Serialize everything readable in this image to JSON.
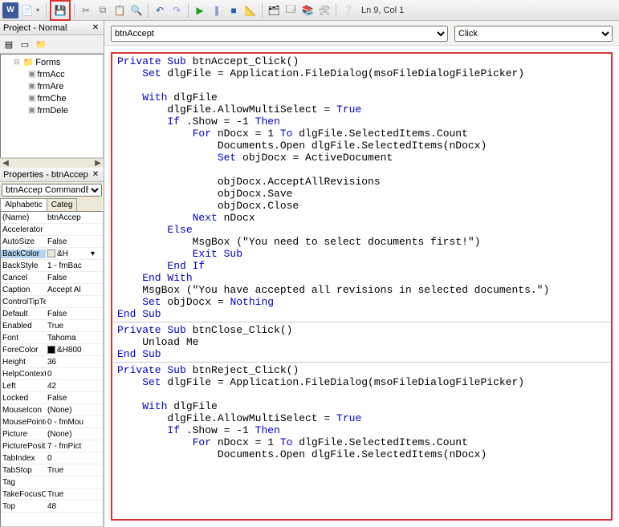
{
  "toolbar": {
    "linecol": "Ln 9, Col 1"
  },
  "project_pane": {
    "title": "Project - Normal",
    "folder": "Forms",
    "items": [
      "frmAcc",
      "frmAre",
      "frmChe",
      "frmDele"
    ]
  },
  "properties_pane": {
    "title": "Properties - btnAccep",
    "object_txt": "btnAccep CommandButton",
    "tabs": {
      "alpha": "Alphabetic",
      "categ": "Categ"
    },
    "rows": [
      {
        "name": "(Name)",
        "value": "btnAccep"
      },
      {
        "name": "Accelerator",
        "value": ""
      },
      {
        "name": "AutoSize",
        "value": "False"
      },
      {
        "name": "BackColor",
        "value": "&H",
        "swatch": "#ece9d8",
        "sel": true,
        "drop": true
      },
      {
        "name": "BackStyle",
        "value": "1 - fmBac"
      },
      {
        "name": "Cancel",
        "value": "False"
      },
      {
        "name": "Caption",
        "value": "Accept Al"
      },
      {
        "name": "ControlTipText",
        "value": ""
      },
      {
        "name": "Default",
        "value": "False"
      },
      {
        "name": "Enabled",
        "value": "True"
      },
      {
        "name": "Font",
        "value": "Tahoma"
      },
      {
        "name": "ForeColor",
        "value": "&H800",
        "swatch": "#000000"
      },
      {
        "name": "Height",
        "value": "36"
      },
      {
        "name": "HelpContextID",
        "value": "0"
      },
      {
        "name": "Left",
        "value": "42"
      },
      {
        "name": "Locked",
        "value": "False"
      },
      {
        "name": "MouseIcon",
        "value": "(None)"
      },
      {
        "name": "MousePointer",
        "value": "0 - fmMou"
      },
      {
        "name": "Picture",
        "value": "(None)"
      },
      {
        "name": "PicturePosition",
        "value": "7 - fmPict"
      },
      {
        "name": "TabIndex",
        "value": "0"
      },
      {
        "name": "TabStop",
        "value": "True"
      },
      {
        "name": "Tag",
        "value": ""
      },
      {
        "name": "TakeFocusOnClick",
        "value": "True"
      },
      {
        "name": "Top",
        "value": "48"
      }
    ]
  },
  "code_header": {
    "object": "btnAccept",
    "proc": "Click"
  },
  "code": {
    "l1a": "Private Sub",
    "l1b": " btnAccept_Click()",
    "l2a": "    Set",
    "l2b": " dlgFile = Application.FileDialog(msoFileDialogFilePicker)",
    "l3a": "    With",
    "l3b": " dlgFile",
    "l4": "        dlgFile.AllowMultiSelect = ",
    "l4k": "True",
    "l5a": "        If",
    "l5b": " .Show = -1 ",
    "l5c": "Then",
    "l6a": "            For",
    "l6b": " nDocx = 1 ",
    "l6c": "To",
    "l6d": " dlgFile.SelectedItems.Count",
    "l7": "                Documents.Open dlgFile.SelectedItems(nDocx)",
    "l8a": "                Set",
    "l8b": " objDocx = ActiveDocument",
    "l9": "                objDocx.AcceptAllRevisions",
    "l10": "                objDocx.Save",
    "l11": "                objDocx.Close",
    "l12a": "            Next",
    "l12b": " nDocx",
    "l13": "        Else",
    "l14": "            MsgBox (\"You need to select documents first!\")",
    "l15": "            Exit Sub",
    "l16": "        End If",
    "l17": "    End With",
    "l18": "    MsgBox (\"You have accepted all revisions in selected documents.\")",
    "l19a": "    Set",
    "l19b": " objDocx = ",
    "l19c": "Nothing",
    "l20": "End Sub",
    "l21a": "Private Sub",
    "l21b": " btnClose_Click()",
    "l22": "    Unload Me",
    "l23": "End Sub",
    "l24a": "Private Sub",
    "l24b": " btnReject_Click()",
    "l25a": "    Set",
    "l25b": " dlgFile = Application.FileDialog(msoFileDialogFilePicker)",
    "l26a": "    With",
    "l26b": " dlgFile",
    "l27": "        dlgFile.AllowMultiSelect = ",
    "l27k": "True",
    "l28a": "        If",
    "l28b": " .Show = -1 ",
    "l28c": "Then",
    "l29a": "            For",
    "l29b": " nDocx = 1 ",
    "l29c": "To",
    "l29d": " dlgFile.SelectedItems.Count",
    "l30": "                Documents.Open dlgFile.SelectedItems(nDocx)"
  }
}
